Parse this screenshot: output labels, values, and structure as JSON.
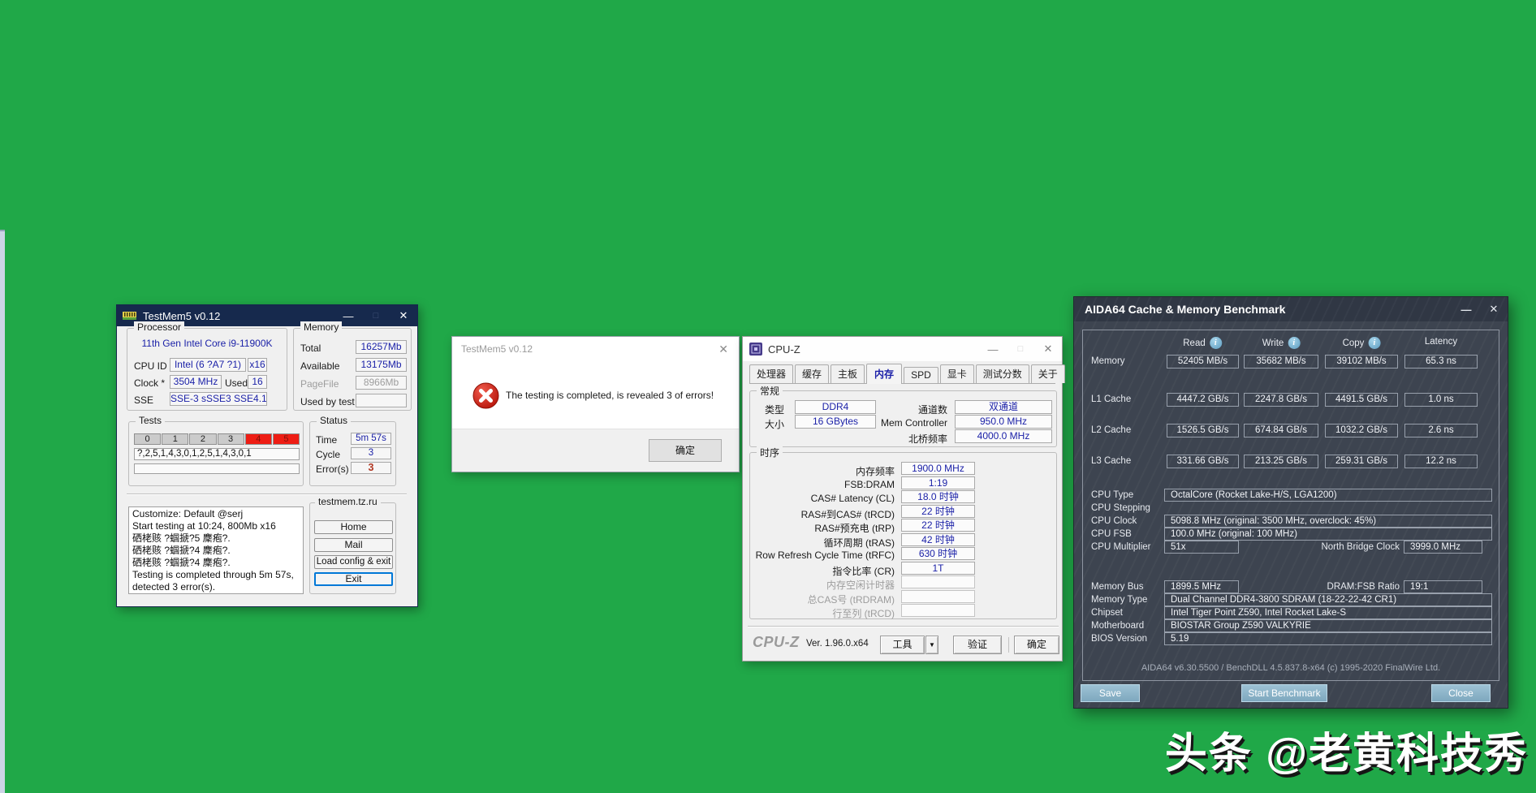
{
  "glyphs": {
    "minimize": "—",
    "maximize": "□",
    "close": "✕",
    "dropdown": "▼"
  },
  "watermark": {
    "text": "头条 @老黄科技秀"
  },
  "testmem5": {
    "title": "TestMem5 v0.12",
    "processor": {
      "caption": "Processor",
      "cpu_name": "11th Gen Intel Core i9-11900K",
      "cpu_id_label": "CPU ID",
      "cpu_id_value": "Intel  (6 ?A7 ?1)",
      "cpu_id_mult": "x16",
      "clock_label": "Clock *",
      "clock_value": "3504 MHz",
      "used_label": "Used",
      "used_value": "16",
      "sse_label": "SSE",
      "sse_value": "SSE-3 sSSE3 SSE4.1"
    },
    "memory": {
      "caption": "Memory",
      "total_label": "Total",
      "total_value": "16257Mb",
      "available_label": "Available",
      "available_value": "13175Mb",
      "pagefile_label": "PageFile",
      "pagefile_value": "8966Mb",
      "used_by_test_label": "Used by test",
      "used_by_test_value": ""
    },
    "tests": {
      "caption": "Tests",
      "cells": [
        "0",
        "1",
        "2",
        "3",
        "4",
        "5"
      ],
      "sequence": "?,2,5,1,4,3,0,1,2,5,1,4,3,0,1"
    },
    "status": {
      "caption": "Status",
      "time_label": "Time",
      "time_value": "5m 57s",
      "cycle_label": "Cycle",
      "cycle_value": "3",
      "errors_label": "Error(s)",
      "errors_value": "3"
    },
    "log_lines": [
      "Customize: Default @serj",
      "Start testing at 10:24, 800Mb x16",
      "硒栳赅 ?蝈搋?5 麇疱?.",
      "硒栳赅 ?蝈搋?4 麇疱?.",
      "硒栳赅 ?蝈搋?4 麇疱?.",
      "Testing is completed through 5m 57s,",
      "detected 3 error(s)."
    ],
    "site": {
      "caption": "testmem.tz.ru",
      "home": "Home",
      "mail": "Mail",
      "load_config": "Load config & exit",
      "exit": "Exit"
    }
  },
  "dialog": {
    "title": "TestMem5 v0.12",
    "message": "The testing is completed, is revealed 3 of errors!",
    "ok": "确定"
  },
  "cpuz": {
    "title": "CPU-Z",
    "tabs": [
      "处理器",
      "缓存",
      "主板",
      "内存",
      "SPD",
      "显卡",
      "测试分数",
      "关于"
    ],
    "general": {
      "caption": "常规",
      "type_label": "类型",
      "type_value": "DDR4",
      "size_label": "大小",
      "size_value": "16 GBytes",
      "channels_label": "通道数",
      "channels_value": "双通道",
      "memctrl_label": "Mem Controller",
      "memctrl_value": "950.0 MHz",
      "nb_label": "北桥频率",
      "nb_value": "4000.0 MHz"
    },
    "timings": {
      "caption": "时序",
      "rows": [
        {
          "label": "内存频率",
          "value": "1900.0 MHz"
        },
        {
          "label": "FSB:DRAM",
          "value": "1:19"
        },
        {
          "label": "CAS# Latency (CL)",
          "value": "18.0 时钟"
        },
        {
          "label": "RAS#到CAS# (tRCD)",
          "value": "22 时钟"
        },
        {
          "label": "RAS#预充电 (tRP)",
          "value": "22 时钟"
        },
        {
          "label": "循环周期 (tRAS)",
          "value": "42 时钟"
        },
        {
          "label": "Row Refresh Cycle Time (tRFC)",
          "value": "630 时钟"
        },
        {
          "label": "指令比率 (CR)",
          "value": "1T"
        },
        {
          "label": "内存空闲计时器",
          "value": ""
        },
        {
          "label": "总CAS号 (tRDRAM)",
          "value": ""
        },
        {
          "label": "行至列 (tRCD)",
          "value": ""
        }
      ]
    },
    "footer": {
      "logo": "CPU-Z",
      "version": "Ver. 1.96.0.x64",
      "tools": "工具",
      "validate": "验证",
      "ok": "确定"
    }
  },
  "aida64": {
    "title": "AIDA64 Cache & Memory Benchmark",
    "columns": [
      "Read",
      "Write",
      "Copy",
      "Latency"
    ],
    "bench_rows": [
      {
        "label": "Memory",
        "read": "52405 MB/s",
        "write": "35682 MB/s",
        "copy": "39102 MB/s",
        "latency": "65.3 ns"
      },
      {
        "label": "L1 Cache",
        "read": "4447.2 GB/s",
        "write": "2247.8 GB/s",
        "copy": "4491.5 GB/s",
        "latency": "1.0 ns"
      },
      {
        "label": "L2 Cache",
        "read": "1526.5 GB/s",
        "write": "674.84 GB/s",
        "copy": "1032.2 GB/s",
        "latency": "2.6 ns"
      },
      {
        "label": "L3 Cache",
        "read": "331.66 GB/s",
        "write": "213.25 GB/s",
        "copy": "259.31 GB/s",
        "latency": "12.2 ns"
      }
    ],
    "props": {
      "cpu_type": {
        "label": "CPU Type",
        "value": "OctalCore   (Rocket Lake-H/S, LGA1200)"
      },
      "cpu_stepping": {
        "label": "CPU Stepping",
        "value": ""
      },
      "cpu_clock": {
        "label": "CPU Clock",
        "value": "5098.8 MHz  (original: 3500 MHz, overclock: 45%)"
      },
      "cpu_fsb": {
        "label": "CPU FSB",
        "value": "100.0 MHz  (original: 100 MHz)"
      },
      "multiplier": {
        "label": "CPU Multiplier",
        "value": "51x",
        "right_label": "North Bridge Clock",
        "right_value": "3999.0 MHz"
      },
      "membus": {
        "label": "Memory Bus",
        "value": "1899.5 MHz",
        "right_label": "DRAM:FSB Ratio",
        "right_value": "19:1"
      },
      "memtype": {
        "label": "Memory Type",
        "value": "Dual Channel DDR4-3800 SDRAM  (18-22-22-42 CR1)"
      },
      "chipset": {
        "label": "Chipset",
        "value": "Intel Tiger Point Z590, Intel Rocket Lake-S"
      },
      "motherboard": {
        "label": "Motherboard",
        "value": "BIOSTAR Group Z590 VALKYRIE"
      },
      "bios": {
        "label": "BIOS Version",
        "value": "5.19"
      }
    },
    "version_line": "AIDA64 v6.30.5500 / BenchDLL 4.5.837.8-x64  (c) 1995-2020 FinalWire Ltd.",
    "buttons": {
      "save": "Save",
      "start": "Start Benchmark",
      "close": "Close"
    }
  }
}
